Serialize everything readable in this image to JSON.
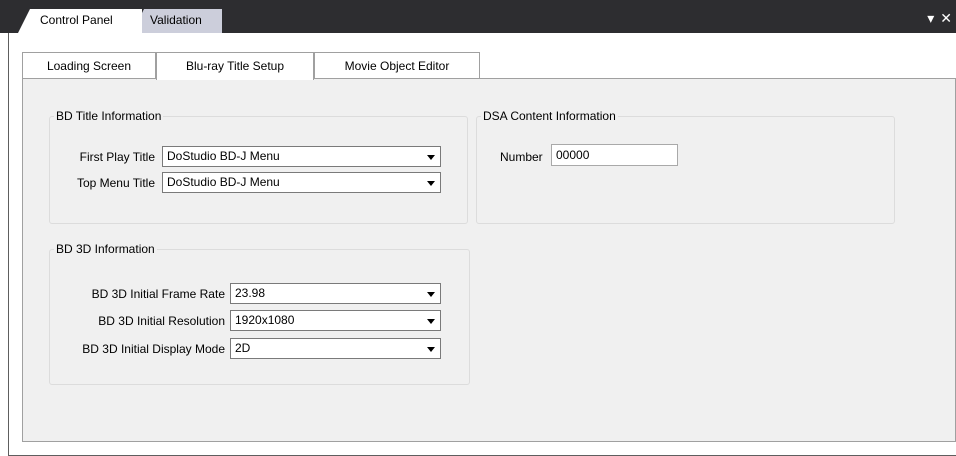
{
  "window": {
    "tabs": [
      {
        "label": "Control Panel",
        "active": true
      },
      {
        "label": "Validation",
        "active": false
      }
    ],
    "controls": {
      "dropdown_icon": "chevron-down-icon",
      "close_icon": "close-icon"
    }
  },
  "tabs": [
    {
      "label": "Loading Screen",
      "active": false
    },
    {
      "label": "Blu-ray Title Setup",
      "active": true
    },
    {
      "label": "Movie Object Editor",
      "active": false
    }
  ],
  "bd_title_info": {
    "title": "BD Title Information",
    "first_play": {
      "label": "First Play Title",
      "value": "DoStudio BD-J Menu"
    },
    "top_menu": {
      "label": "Top Menu Title",
      "value": "DoStudio BD-J Menu"
    }
  },
  "dsa_content_info": {
    "title": "DSA Content Information",
    "number": {
      "label": "Number",
      "value": "00000"
    }
  },
  "bd_3d_info": {
    "title": "BD 3D Information",
    "frame_rate": {
      "label": "BD 3D Initial Frame Rate",
      "value": "23.98"
    },
    "resolution": {
      "label": "BD 3D Initial Resolution",
      "value": "1920x1080"
    },
    "display_mode": {
      "label": "BD 3D Initial Display Mode",
      "value": "2D"
    }
  },
  "colors": {
    "titlebar": "#2d2d30",
    "tab_active": "#ffffff",
    "tab_inactive": "#cccedb",
    "page_bg": "#f0f0f0"
  }
}
